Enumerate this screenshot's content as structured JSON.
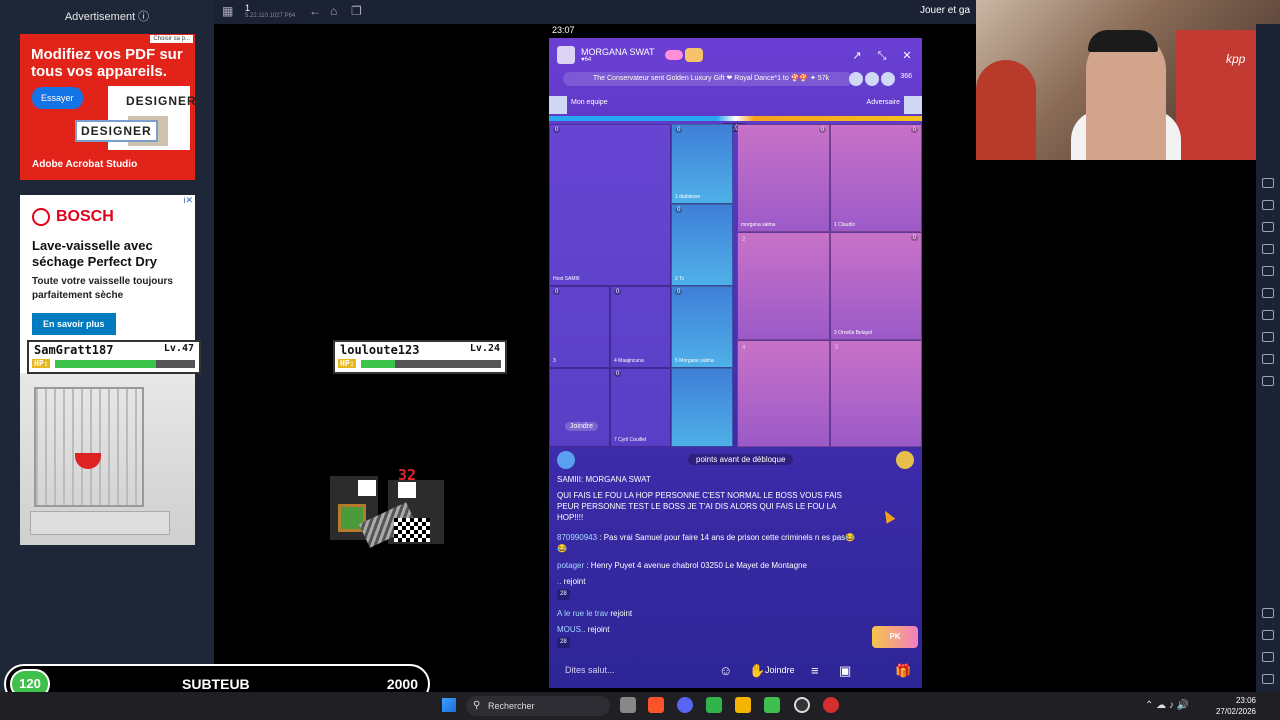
{
  "ad_column": {
    "header": "Advertisement ⓘ",
    "adobe": {
      "badge": "Choisir sa p...",
      "title": "Modifiez vos PDF sur tous vos appareils.",
      "button": "Essayer",
      "card_text": "DESIGNER",
      "overlay_text": "DESIGNER",
      "brand": "Adobe Acrobat Studio"
    },
    "bosch": {
      "brand": "BOSCH",
      "adchoices": "i✕",
      "headline": "Lave-vaisselle avec séchage Perfect Dry",
      "subline": "Toute votre vaisselle toujours parfaitement sèche",
      "cta": "En savoir plus"
    }
  },
  "players": [
    {
      "name": "SamGratt187",
      "level": "Lv.47",
      "hp_label": "HP:",
      "hp_fraction": 0.72
    },
    {
      "name": "louloute123",
      "level": "Lv.24",
      "hp_label": "HP:",
      "hp_fraction": 0.24
    }
  ],
  "damage_number": "32",
  "score_bar": {
    "level": "120",
    "name": "SUBTEUB",
    "value": "2000"
  },
  "emulator": {
    "instance": "1",
    "version": "5.22.110.1027  P64",
    "jouer": "Jouer et ga"
  },
  "phone": {
    "status_time": "23:07",
    "host_name": "MORGANA SWAT",
    "host_likes": "♥64",
    "ticker": "The Conservateur sent Golden Luxury Gift ❤ Royal Dance*1 to 🍄🍄 ✦ 57k",
    "viewers": "366",
    "my_team": "Mon equipe",
    "opponent": "Adversaire",
    "timer": "22:01",
    "cells": [
      {
        "badge": "0",
        "name": "SAMIII",
        "prefix": "Host"
      },
      {
        "badge": "0",
        "name": "diablesse",
        "slot": "1"
      },
      {
        "badge": "0",
        "name": "Tc",
        "slot": "2"
      },
      {
        "badge": "0",
        "name": "",
        "slot": "3"
      },
      {
        "badge": "0",
        "name": "Maajincuna",
        "slot": "4"
      },
      {
        "badge": "0",
        "name": "Morgane salma",
        "slot": "5"
      },
      {
        "badge": "0",
        "name": "Cyril Couillet",
        "slot": "7"
      },
      {
        "badge": "0",
        "name": "morgana salma"
      },
      {
        "badge": "0",
        "name": "Claudio",
        "slot": "1"
      },
      {
        "slot": "2"
      },
      {
        "badge": "0",
        "name": "Ornella Belayel",
        "slot": "3"
      },
      {
        "slot": "4"
      },
      {
        "slot": "5"
      }
    ],
    "join_button": "Joindre",
    "unlock_text": "points avant de débloque",
    "chat": [
      {
        "name": "",
        "text": "SAMIII: MORGANA SWAT"
      },
      {
        "name": "",
        "text": "QUI FAIS LE FOU LA HOP PERSONNE C'EST NORMAL LE BOSS VOUS FAIS PEUR PERSONNE TEST LE BOSS JE T'AI DIS ALORS QUI FAIS LE FOU LA HOP!!!!"
      },
      {
        "name": "870990943",
        "text": " : Pas vrai Samuel  pour faire 14 ans de prison cette criminels n es pas😂😂"
      },
      {
        "name": "potager",
        "text": " : Henry Puyet  4 avenue chabrol 03250 Le Mayet de Montagne"
      },
      {
        "name": "..",
        "text": " rejoint",
        "count": "28"
      },
      {
        "name": "A le rue le trav",
        "text": " rejoint"
      },
      {
        "name": "MOUS..",
        "text": " rejoint",
        "count": "28"
      }
    ],
    "pk": "PK",
    "input_placeholder": "Dites salut...",
    "join_label": "Joindre"
  },
  "taskbar": {
    "search": "Rechercher",
    "time": "23:06",
    "date": "27/02/2026"
  }
}
